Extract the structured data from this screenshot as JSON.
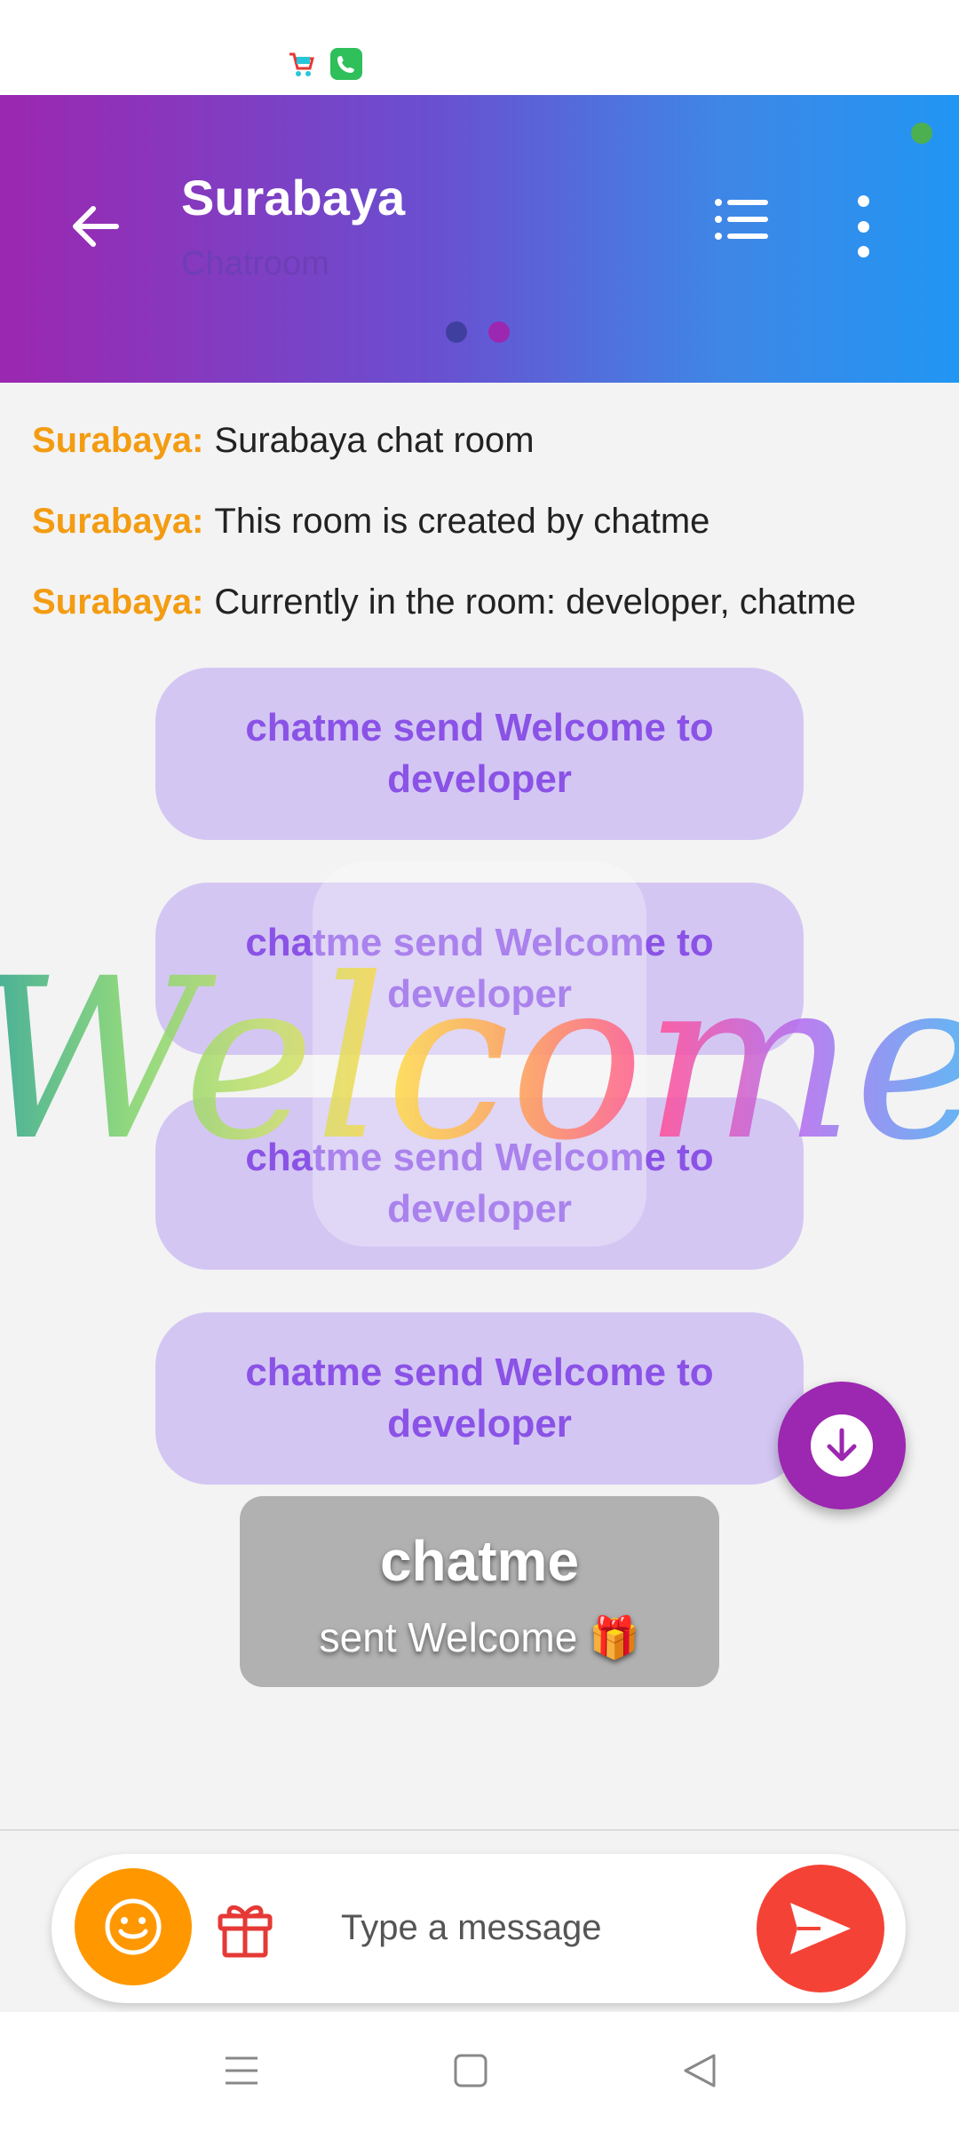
{
  "header": {
    "title": "Surabaya",
    "subtitle": "Chatroom",
    "gradient_colors": [
      "#9c27b0",
      "#2196f3"
    ],
    "page_dots": [
      {
        "color": "#3f3f9f",
        "active": false
      },
      {
        "color": "#9c27b0",
        "active": true
      }
    ]
  },
  "system_messages": [
    {
      "sender": "Surabaya:",
      "text": "Surabaya chat room"
    },
    {
      "sender": "Surabaya:",
      "text": "This room is created by chatme"
    },
    {
      "sender": "Surabaya:",
      "text": "Currently in the room: developer, chatme"
    }
  ],
  "gift_messages": [
    {
      "text": "chatme send Welcome to developer"
    },
    {
      "text": "chatme send Welcome to developer"
    },
    {
      "text": "chatme send Welcome to developer"
    },
    {
      "text": "chatme send Welcome to developer"
    }
  ],
  "gift_toast": {
    "sender": "chatme",
    "text": "sent Welcome 🎁"
  },
  "overlay": {
    "word": "Welcome"
  },
  "input": {
    "placeholder": "Type a message",
    "value": ""
  },
  "colors": {
    "sender_name": "#f39c12",
    "gift_bubble_bg": "#d4c6f3",
    "gift_bubble_text": "#8a52e6",
    "emoji_button": "#ff9800",
    "send_button": "#f44336",
    "scroll_button": "#9c27b0"
  },
  "icons": {
    "back": "arrow-left-icon",
    "list": "list-icon",
    "more": "more-vertical-icon",
    "emoji": "smiley-icon",
    "gift": "gift-icon",
    "send": "send-icon",
    "scroll": "arrow-down-circle-icon"
  }
}
